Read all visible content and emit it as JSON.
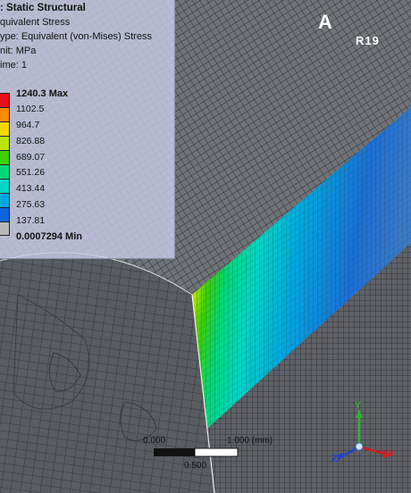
{
  "legend": {
    "title": ": Static Structural",
    "result": "quivalent Stress",
    "type": "ype: Equivalent (von-Mises) Stress",
    "unit": "nit: MPa",
    "time": "ime: 1",
    "entries": [
      {
        "label": "1240.3 Max",
        "color": "#e8101a"
      },
      {
        "label": "1102.5",
        "color": "#ff8a00"
      },
      {
        "label": "964.7",
        "color": "#f5d800"
      },
      {
        "label": "826.88",
        "color": "#b8e600"
      },
      {
        "label": "689.07",
        "color": "#3ed000"
      },
      {
        "label": "551.26",
        "color": "#00d878"
      },
      {
        "label": "413.44",
        "color": "#00d6c4"
      },
      {
        "label": "275.63",
        "color": "#00a8e0"
      },
      {
        "label": "137.81",
        "color": "#1066e0"
      },
      {
        "label": "0.0007294 Min",
        "color": "#b8b8b8"
      }
    ]
  },
  "logo": {
    "main": "A",
    "sub": "R19"
  },
  "scale_bar": {
    "left_label": "0.000",
    "right_label": "1.000 (mm)",
    "mid_label": "0.500"
  },
  "triad": {
    "x_label": "X",
    "y_label": "Y",
    "z_label": "Z"
  },
  "colors": {
    "mesh_surface": "#6b6e73",
    "mesh_line": "#2a2c30",
    "legend_bg": "#cdd0ec"
  }
}
